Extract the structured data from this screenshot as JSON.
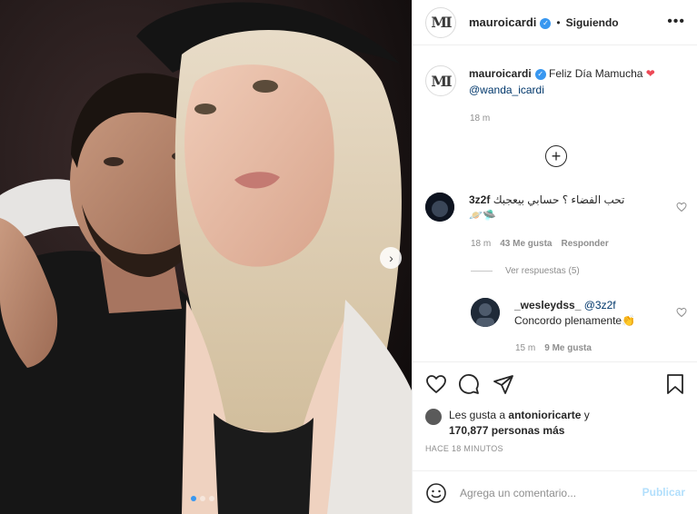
{
  "header": {
    "username": "mauroicardi",
    "separator": "•",
    "follow_status": "Siguiendo",
    "more": "•••",
    "avatar_logo": "MI"
  },
  "caption": {
    "username": "mauroicardi",
    "text": "Feliz Día Mamucha",
    "emoji": "❤",
    "mention": "@wanda_icardi",
    "time": "18 m"
  },
  "load_more": "+",
  "comments": [
    {
      "username": "3z2f",
      "text": "تحب الفضاء ؟ حسابي بيعجبك",
      "emoji": "🪐🛸",
      "time": "18 m",
      "likes": "43 Me gusta",
      "reply": "Responder",
      "view_replies": "Ver respuestas (5)"
    },
    {
      "username": "_wesleydss_",
      "mention": "@3z2f",
      "text": "Concordo plenamente",
      "emoji": "👏",
      "time": "15 m",
      "likes": "9 Me gusta"
    }
  ],
  "likes": {
    "prefix": "Les gusta a",
    "user": "antonioricarte",
    "connector": "y",
    "count": "170,877",
    "suffix": "personas más"
  },
  "timestamp": "HACE 18 MINUTOS",
  "add_comment": {
    "placeholder": "Agrega un comentario...",
    "publish": "Publicar"
  },
  "carousel": {
    "next": "›",
    "total": 3,
    "active": 0
  },
  "colors": {
    "accent": "#3897f0",
    "heart": "#ed4956",
    "mention": "#00376b",
    "muted": "#8e8e8e",
    "publish_disabled": "#b2dffc"
  },
  "icons": [
    "heart-outline-icon",
    "comment-icon",
    "share-icon",
    "bookmark-icon",
    "emoji-icon",
    "verified-icon",
    "more-icon",
    "plus-circle-icon"
  ]
}
